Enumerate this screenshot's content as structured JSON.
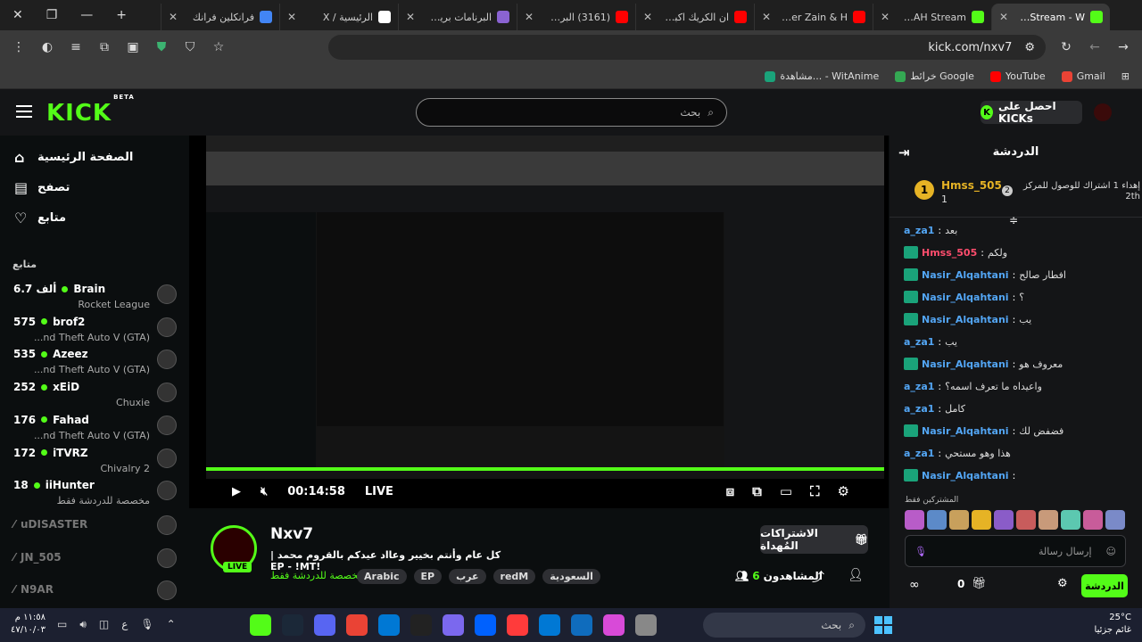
{
  "browser": {
    "tabs": [
      {
        "title": "فرانكلين فرانك",
        "color": "#4285f4"
      },
      {
        "title": "الرئيسية / X",
        "color": "#ffffff"
      },
      {
        "title": "البرنامات بريميوم",
        "color": "#8a63d2"
      },
      {
        "title": "(3161) البرت مجاني",
        "color": "#ff0000"
      },
      {
        "title": "ان الكريك اكبر من",
        "color": "#ff0000"
      },
      {
        "title": "Maher Zain & H",
        "color": "#ff0000"
      },
      {
        "title": "OSAMAH Stream",
        "color": "#53fc18"
      },
      {
        "title": "Nxv7 Stream - W",
        "color": "#53fc18",
        "active": true
      }
    ],
    "url": "kick.com/nxv7",
    "bookmarks": [
      {
        "label": "Gmail",
        "color": "#ea4335"
      },
      {
        "label": "YouTube",
        "color": "#ff0000"
      },
      {
        "label": "خرائط Google",
        "color": "#34a853"
      },
      {
        "label": "مشاهدة... - WitAnime",
        "color": "#1aa37a"
      }
    ]
  },
  "kick": {
    "beta": "BETA",
    "search_placeholder": "بحث",
    "get_kicks": "احصل على KICKs"
  },
  "sidebar": {
    "nav": [
      {
        "label": "الصفحة الرئيسية",
        "icon": "home-icon"
      },
      {
        "label": "تصفح",
        "icon": "browse-icon"
      },
      {
        "label": "متابع",
        "icon": "heart-icon"
      }
    ],
    "following_header": "متابع",
    "channels": [
      {
        "name": "Brain",
        "viewers": "6.7 ألف",
        "category": "Rocket League",
        "live": true
      },
      {
        "name": "brof2",
        "viewers": "575",
        "category": "...nd Theft Auto V (GTA)",
        "live": true
      },
      {
        "name": "Azeez",
        "viewers": "535",
        "category": "...nd Theft Auto V (GTA)",
        "live": true
      },
      {
        "name": "xEiD",
        "viewers": "252",
        "category": "Chuxie",
        "live": true
      },
      {
        "name": "Fahad",
        "viewers": "176",
        "category": "...nd Theft Auto V (GTA)",
        "live": true
      },
      {
        "name": "iTVRZ",
        "viewers": "172",
        "category": "Chivalry 2",
        "live": true
      },
      {
        "name": "iiHunter",
        "viewers": "18",
        "category": "مخصصة للدردشة فقط",
        "live": true
      },
      {
        "name": "uDISASTER",
        "viewers": "",
        "category": "",
        "live": false
      },
      {
        "name": "JN_505",
        "viewers": "",
        "category": "",
        "live": false
      },
      {
        "name": "N9AR",
        "viewers": "",
        "category": "",
        "live": false
      }
    ]
  },
  "player": {
    "time": "00:14:58",
    "live_label": "LIVE"
  },
  "stream": {
    "channel": "Nxv7",
    "live_badge": "LIVE",
    "title": "كل عام وأنتم بخيير وعااد عيدكم بالقروم محمد | !EP - !MT",
    "category": "مخصصة للدردشة فقط",
    "tags": [
      "السعودية",
      "redM",
      "عرب",
      "EP",
      "Arabic"
    ],
    "gift_button": "الاشتراكات المُهداة",
    "viewers_label": "المشاهدون",
    "viewers_count": "6"
  },
  "chat": {
    "header": "الدردشة",
    "pinned": {
      "rank1": "1",
      "user": "Hmss_505",
      "count": "1",
      "rank2": "2",
      "text": "إهداء 1 اشتراك للوصول للمركز 2th"
    },
    "messages": [
      {
        "user": "a_za1",
        "color": "#53a6f5",
        "text": "بعد",
        "badge": false
      },
      {
        "user": "Hmss_505",
        "color": "#ff4d6d",
        "text": "ولكم",
        "badge": true
      },
      {
        "user": "Nasir_Alqahtani",
        "color": "#53a6f5",
        "text": "افطار صالح",
        "badge": true
      },
      {
        "user": "Nasir_Alqahtani",
        "color": "#53a6f5",
        "text": "؟",
        "badge": true
      },
      {
        "user": "Nasir_Alqahtani",
        "color": "#53a6f5",
        "text": "يب",
        "badge": true
      },
      {
        "user": "a_za1",
        "color": "#53a6f5",
        "text": "يب",
        "badge": false
      },
      {
        "user": "Nasir_Alqahtani",
        "color": "#53a6f5",
        "text": "معروف هو",
        "badge": true
      },
      {
        "user": "a_za1",
        "color": "#53a6f5",
        "text": "واعيداه ما تعرف اسمه؟",
        "badge": false
      },
      {
        "user": "a_za1",
        "color": "#53a6f5",
        "text": "كامل",
        "badge": false
      },
      {
        "user": "Nasir_Alqahtani",
        "color": "#53a6f5",
        "text": "فضفض لك",
        "badge": true
      },
      {
        "user": "a_za1",
        "color": "#53a6f5",
        "text": "هذا وهو مستحي",
        "badge": false
      },
      {
        "user": "Nasir_Alqahtani",
        "color": "#53a6f5",
        "text": "",
        "badge": true
      }
    ],
    "subs_label": "المشتركين فقط",
    "input_placeholder": "إرسال رسالة",
    "kicks_count": "0",
    "chat_button": "الدردشة"
  },
  "taskbar": {
    "search": "بحث",
    "weather_temp": "25°C",
    "weather_desc": "غائم جزئيا",
    "time": "١١:٥٨ م",
    "date": "٤٧/١٠/٠٣",
    "lang": "ع"
  }
}
